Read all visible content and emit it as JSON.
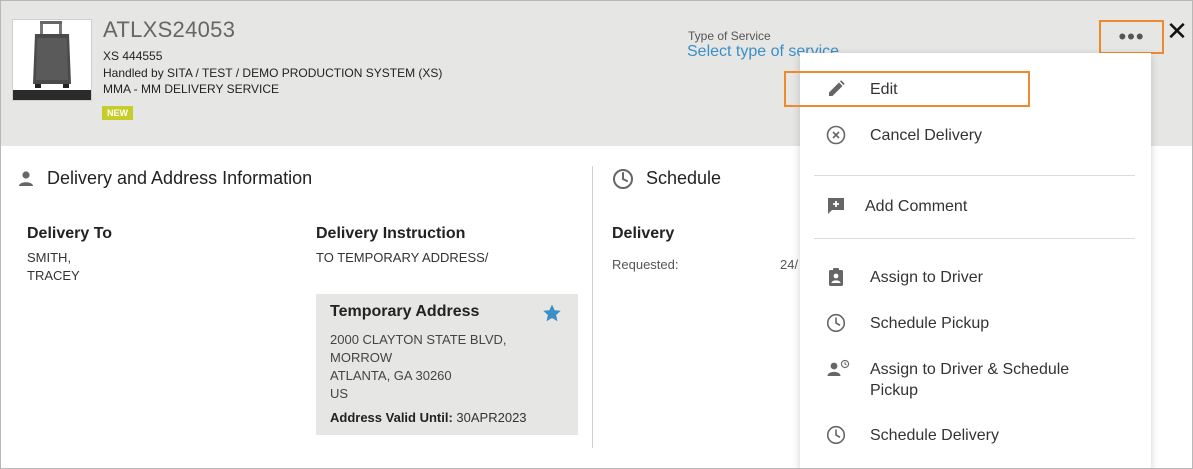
{
  "header": {
    "bag_tag": "ATLXS24053",
    "reference": "XS 444555",
    "handled_by": "Handled by SITA / TEST / DEMO PRODUCTION SYSTEM (XS)",
    "service_name": "MMA - MM DELIVERY SERVICE",
    "status_badge": "NEW",
    "service_type_label": "Type of Service",
    "service_type_link": "Select type of service",
    "more_button": "•••",
    "close_button": "✕"
  },
  "delivery_section": {
    "title": "Delivery and Address Information",
    "delivery_to_label": "Delivery To",
    "delivery_to_lines": [
      "SMITH,",
      "TRACEY"
    ],
    "instruction_label": "Delivery Instruction",
    "instruction_value": "TO TEMPORARY ADDRESS/",
    "temp_address": {
      "title": "Temporary Address",
      "lines": [
        "2000 CLAYTON STATE BLVD,",
        "MORROW",
        "ATLANTA, GA 30260",
        "US"
      ],
      "valid_label": "Address Valid Until:",
      "valid_value": " 30APR2023"
    }
  },
  "schedule_section": {
    "title": "Schedule",
    "delivery_label": "Delivery",
    "requested_label": "Requested:",
    "requested_value": "24/"
  },
  "menu": {
    "items": [
      {
        "label": "Edit",
        "icon": "pencil-icon"
      },
      {
        "label": "Cancel Delivery",
        "icon": "cancel-circle-icon"
      },
      {
        "label": "Add Comment",
        "icon": "add-comment-icon"
      },
      {
        "label": "Assign to Driver",
        "icon": "clipboard-person-icon"
      },
      {
        "label": "Schedule Pickup",
        "icon": "clock-icon"
      },
      {
        "label": "Assign to Driver & Schedule Pickup",
        "icon": "person-clock-icon"
      },
      {
        "label": "Schedule Delivery",
        "icon": "clock-icon"
      }
    ]
  },
  "colors": {
    "header_bg": "#e6e6e4",
    "accent_orange": "#f0892d",
    "link_blue": "#3a8fc7",
    "badge_green": "#c6cc2a"
  }
}
